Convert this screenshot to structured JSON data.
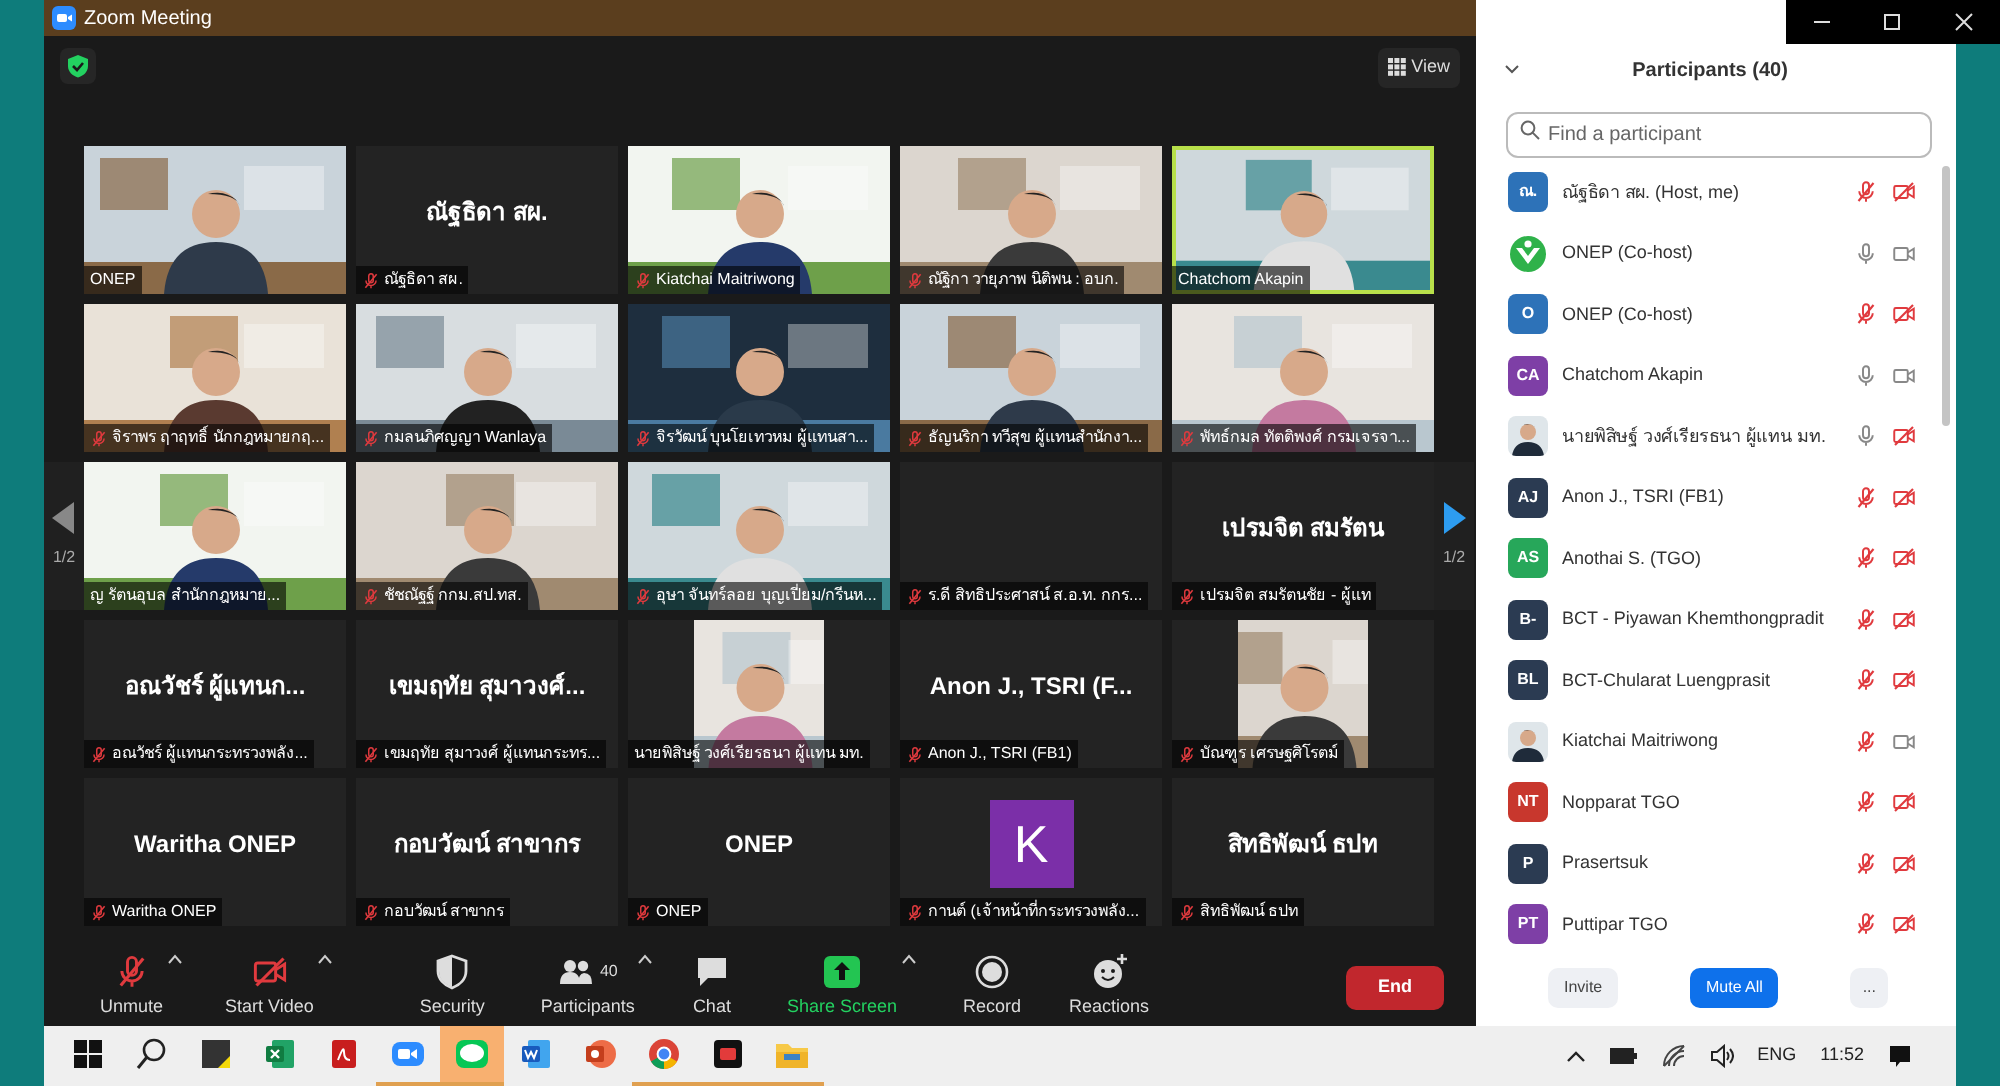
{
  "window": {
    "title": "Zoom Meeting",
    "view_label": "View"
  },
  "gallery": {
    "page": "1/2",
    "page_right": "1/2",
    "tiles": [
      {
        "kind": "video",
        "label": "ONEP",
        "muted": false,
        "speaking": false
      },
      {
        "kind": "name",
        "display_name": "ณัฐธิดา สผ.",
        "label": "ณัฐธิดา สผ.",
        "muted": true,
        "speaking": false
      },
      {
        "kind": "video",
        "label": "Kiatchai Maitriwong",
        "muted": true,
        "speaking": false
      },
      {
        "kind": "video",
        "label": "ณัฐิกา วายุภาพ นิติพน : อบก.",
        "muted": true,
        "speaking": false
      },
      {
        "kind": "video",
        "label": "Chatchom Akapin",
        "muted": false,
        "speaking": true
      },
      {
        "kind": "video",
        "label": "จิราพร ฤาฤทธิ์ นักกฎหมายกฤ...",
        "muted": true,
        "speaking": false
      },
      {
        "kind": "video",
        "label": "กมลนภิศญญา Wanlaya",
        "muted": true,
        "speaking": false
      },
      {
        "kind": "video",
        "label": "จิรวัฒน์ บุนโยเทวหม ผู้แทนสา...",
        "muted": true,
        "speaking": false
      },
      {
        "kind": "video",
        "label": "ธัญนริกา ทวีสุข ผู้แทนสำนักงา...",
        "muted": true,
        "speaking": false
      },
      {
        "kind": "video",
        "label": "พัทธ์กมล ทัตติพงศ์ กรมเจรจา...",
        "muted": true,
        "speaking": false
      },
      {
        "kind": "video",
        "label": "ญ รัตนอุบล สำนักกฎหมาย...",
        "muted": false,
        "speaking": false
      },
      {
        "kind": "video",
        "label": "ชัชณัฐฐ์ กกม.สป.ทส.",
        "muted": true,
        "speaking": false
      },
      {
        "kind": "video",
        "label": "อุษา จันทร์ลอย บุญเปี่ยม/กรีนห...",
        "muted": true,
        "speaking": false
      },
      {
        "kind": "blank",
        "label": "ร.ดี สิทธิประศาสน์ ส.อ.ท. กกร...",
        "muted": true,
        "speaking": false
      },
      {
        "kind": "name",
        "display_name": "เปรมจิต สมรัตน",
        "label": "เปรมจิต สมรัตนชัย - ผู้แท",
        "muted": true,
        "speaking": false
      },
      {
        "kind": "name",
        "display_name": "อณวัชร์ ผู้แทนก...",
        "label": "อณวัชร์ ผู้แทนกระทรวงพลัง...",
        "muted": true,
        "speaking": false
      },
      {
        "kind": "name",
        "display_name": "เขมฤทัย สุมาวงศ์...",
        "label": "เขมฤทัย สุมาวงศ์ ผู้แทนกระทร...",
        "muted": true,
        "speaking": false
      },
      {
        "kind": "portrait",
        "label": "นายพิสิษฐ์ วงศ์เรียรธนา ผู้แทน มท.",
        "muted": false,
        "speaking": false
      },
      {
        "kind": "name",
        "display_name": "Anon J., TSRI (F...",
        "label": "Anon J., TSRI (FB1)",
        "muted": true,
        "speaking": false
      },
      {
        "kind": "portrait",
        "label": "บัณฑูร เศรษฐศิโรตม์",
        "muted": true,
        "speaking": false
      },
      {
        "kind": "name",
        "display_name": "Waritha ONEP",
        "label": "Waritha ONEP",
        "muted": true,
        "speaking": false
      },
      {
        "kind": "name",
        "display_name": "กอบวัฒน์ สาขากร",
        "label": "กอบวัฒน์ สาขากร",
        "muted": true,
        "speaking": false
      },
      {
        "kind": "name",
        "display_name": "ONEP",
        "label": "ONEP",
        "muted": true,
        "speaking": false
      },
      {
        "kind": "avatar",
        "letter": "K",
        "color": "#7b2fa8",
        "label": "กานต์ (เจ้าหน้าที่กระทรวงพลัง...",
        "muted": true,
        "speaking": false
      },
      {
        "kind": "name",
        "display_name": "สิทธิพัฒน์ ธปท",
        "label": "สิทธิพัฒน์ ธปท",
        "muted": true,
        "speaking": false
      }
    ]
  },
  "toolbar": {
    "items": [
      {
        "kind": "audio",
        "label": "Unmute",
        "muted": true,
        "menu": true
      },
      {
        "kind": "video",
        "label": "Start Video",
        "muted": true,
        "menu": true
      },
      {
        "kind": "security",
        "label": "Security",
        "menu": false
      },
      {
        "kind": "participants",
        "label": "Participants",
        "count": "40",
        "menu": true
      },
      {
        "kind": "chat",
        "label": "Chat",
        "menu": false
      },
      {
        "kind": "share",
        "label": "Share Screen",
        "menu": true
      },
      {
        "kind": "record",
        "label": "Record",
        "menu": false
      },
      {
        "kind": "reactions",
        "label": "Reactions",
        "menu": false
      }
    ],
    "end_button": "End"
  },
  "participants": {
    "title": "Participants (40)",
    "search": {
      "placeholder": "Find a participant"
    },
    "list": [
      {
        "kind": "initials",
        "initials": "ณ.",
        "color": "#2d72b8",
        "name": "ณัฐธิดา สผ. (Host, me)",
        "muted": true,
        "video_on": false
      },
      {
        "kind": "logo",
        "name": "ONEP (Co-host)",
        "muted": false,
        "video_on": true
      },
      {
        "kind": "initials",
        "initials": "O",
        "color": "#2d72b8",
        "name": "ONEP (Co-host)",
        "muted": true,
        "video_on": false
      },
      {
        "kind": "initials",
        "initials": "CA",
        "color": "#7e3fa6",
        "name": "Chatchom Akapin",
        "muted": false,
        "video_on": true
      },
      {
        "kind": "picture",
        "name": "นายพิสิษฐ์ วงศ์เรียรธนา ผู้แทน มท.",
        "muted": false,
        "video_on": false
      },
      {
        "kind": "initials",
        "initials": "AJ",
        "color": "#2b3b52",
        "name": "Anon J., TSRI (FB1)",
        "muted": true,
        "video_on": false
      },
      {
        "kind": "initials",
        "initials": "AS",
        "color": "#27a75a",
        "name": "Anothai S. (TGO)",
        "muted": true,
        "video_on": false
      },
      {
        "kind": "initials",
        "initials": "B-",
        "color": "#2b3b52",
        "name": "BCT - Piyawan Khemthongpradit",
        "muted": true,
        "video_on": false
      },
      {
        "kind": "initials",
        "initials": "BL",
        "color": "#2b3b52",
        "name": "BCT-Chularat Luengprasit",
        "muted": true,
        "video_on": false
      },
      {
        "kind": "picture",
        "name": "Kiatchai Maitriwong",
        "muted": true,
        "video_on": true
      },
      {
        "kind": "initials",
        "initials": "NT",
        "color": "#c8372d",
        "name": "Nopparat TGO",
        "muted": true,
        "video_on": false
      },
      {
        "kind": "initials",
        "initials": "P",
        "color": "#2b3b52",
        "name": "Prasertsuk",
        "muted": true,
        "video_on": false
      },
      {
        "kind": "initials",
        "initials": "PT",
        "color": "#7e3fa6",
        "name": "Puttipar TGO",
        "muted": true,
        "video_on": false
      }
    ],
    "buttons": {
      "invite": "Invite",
      "mute_all": "Mute All",
      "more": "..."
    }
  },
  "taskbar": {
    "apps": [
      {
        "kind": "start",
        "running": false,
        "selected": false
      },
      {
        "kind": "search",
        "running": false,
        "selected": false
      },
      {
        "kind": "notes",
        "running": false,
        "selected": false
      },
      {
        "kind": "spreadsheet",
        "running": false,
        "selected": false
      },
      {
        "kind": "pdf",
        "running": false,
        "selected": false
      },
      {
        "kind": "meeting",
        "running": true,
        "selected": false
      },
      {
        "kind": "messenger",
        "running": true,
        "selected": true
      },
      {
        "kind": "document",
        "running": false,
        "selected": false
      },
      {
        "kind": "slides",
        "running": false,
        "selected": false
      },
      {
        "kind": "browser",
        "running": true,
        "selected": false
      },
      {
        "kind": "recorder",
        "running": true,
        "selected": false
      },
      {
        "kind": "folder",
        "running": true,
        "selected": false
      }
    ],
    "language": "ENG",
    "time": "11:52"
  }
}
